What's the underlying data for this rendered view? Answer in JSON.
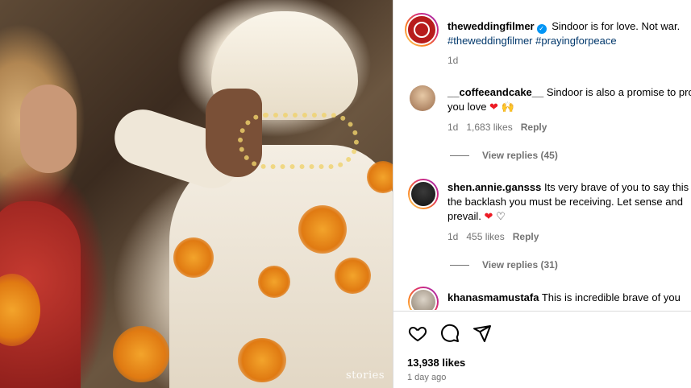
{
  "photo": {
    "watermark": "stories"
  },
  "post": {
    "username": "theweddingfilmer",
    "caption_text": "Sindoor is for love. Not war.",
    "hashtags": "#theweddingfilmer #prayingforpeace",
    "time": "1d",
    "brand_color": "#b71c1c"
  },
  "comments": [
    {
      "username": "__coffeeandcake__",
      "line1": "Sindoor is also a promise to protect the",
      "line2_text": "you love",
      "time": "1d",
      "likes": "1,683 likes",
      "reply": "Reply",
      "view_replies": "View replies (45)"
    },
    {
      "username": "shen.annie.gansss",
      "line1": "Its very brave of you to say this given",
      "line2": "the backlash you must be receiving. Let sense and",
      "line3_text": "prevail.",
      "time": "1d",
      "likes": "455 likes",
      "reply": "Reply",
      "view_replies": "View replies (31)"
    },
    {
      "username": "khanasmamustafa",
      "line1": "This is incredible brave of you"
    }
  ],
  "actions": {
    "like_icon": "heart-outline-icon",
    "comment_icon": "comment-icon",
    "share_icon": "paper-plane-icon"
  },
  "likes_count": "13,938 likes",
  "posted_ago": "1 day ago",
  "colors": {
    "link": "#00376b",
    "verified": "#0095f6",
    "muted": "#737373",
    "heart": "#ed1b24"
  }
}
